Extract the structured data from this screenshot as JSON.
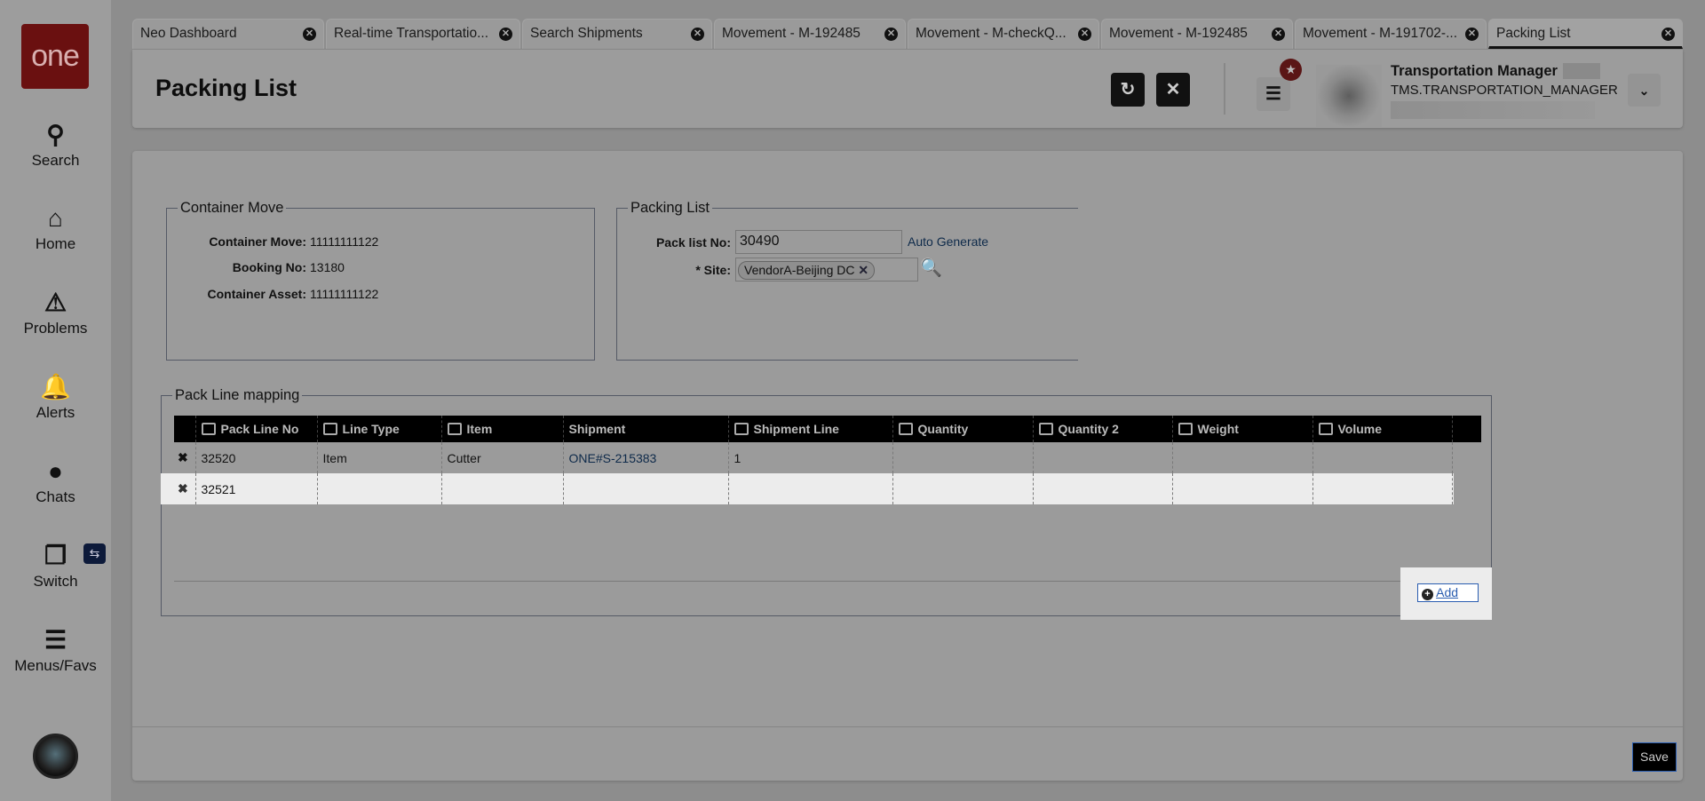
{
  "sidebar": {
    "logo": "one",
    "items": [
      {
        "label": "Search",
        "icon": "search-icon"
      },
      {
        "label": "Home",
        "icon": "home-icon"
      },
      {
        "label": "Problems",
        "icon": "warning-icon"
      },
      {
        "label": "Alerts",
        "icon": "bell-icon"
      },
      {
        "label": "Chats",
        "icon": "chat-icon"
      },
      {
        "label": "Switch",
        "icon": "switch-icon"
      },
      {
        "label": "Menus/Favs",
        "icon": "menu-icon"
      }
    ]
  },
  "tabs": [
    "Neo Dashboard",
    "Real-time Transportatio...",
    "Search Shipments",
    "Movement - M-192485",
    "Movement - M-checkQ...",
    "Movement - M-192485",
    "Movement - M-191702-...",
    "Packing List"
  ],
  "header": {
    "title": "Packing List",
    "user_name": "Transportation Manager",
    "user_role": "TMS.TRANSPORTATION_MANAGER"
  },
  "container_move": {
    "legend": "Container Move",
    "fields": [
      {
        "label": "Container Move:",
        "value": "11111111122"
      },
      {
        "label": "Booking No:",
        "value": "13180"
      },
      {
        "label": "Container Asset:",
        "value": "11111111122"
      }
    ]
  },
  "packing_list": {
    "legend": "Packing List",
    "pack_list_no_label": "Pack list No:",
    "pack_list_no": "30490",
    "auto_generate": "Auto Generate",
    "site_label": "* Site:",
    "site_value": "VendorA-Beijing DC"
  },
  "pack_lines": {
    "legend": "Pack Line mapping",
    "columns": [
      "Pack Line No",
      "Line Type",
      "Item",
      "Shipment",
      "Shipment Line",
      "Quantity",
      "Quantity 2",
      "Weight",
      "Volume"
    ],
    "rows": [
      [
        "32520",
        "Item",
        "Cutter",
        "ONE#S-215383",
        "1",
        "",
        "",
        "",
        ""
      ],
      [
        "32521",
        "",
        "",
        "",
        "",
        "",
        "",
        "",
        ""
      ]
    ],
    "add_label": "Add"
  },
  "footer": {
    "save_label": "Save"
  }
}
